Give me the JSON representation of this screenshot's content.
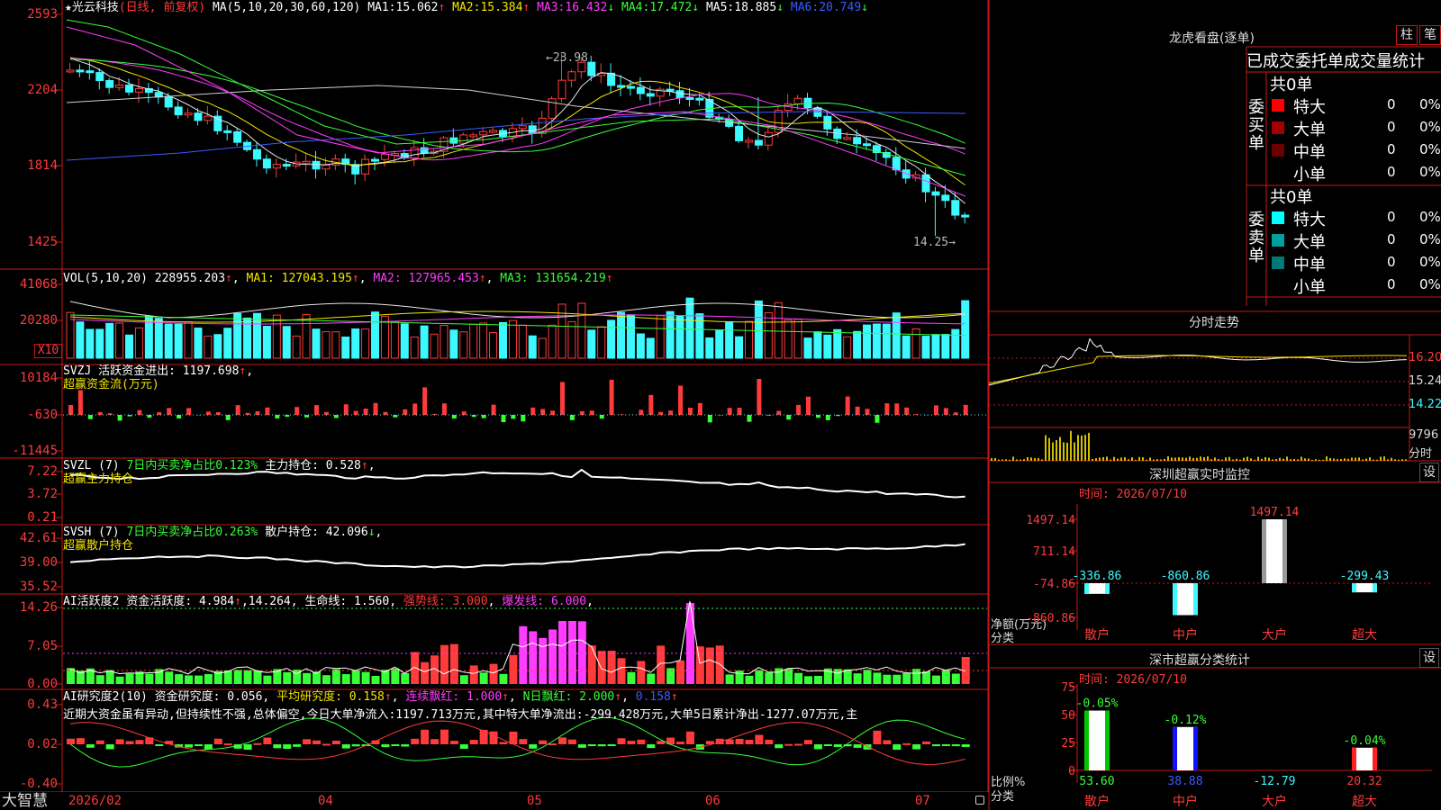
{
  "colors": {
    "up": "#ff3b3b",
    "down": "#3cf8ff",
    "border": "#c81818",
    "ma1": "#f2e600",
    "ma2": "#ff3cff",
    "ma3": "#38ff38",
    "ma4": "#3a5cff",
    "ma5": "#e6e6e6",
    "ma6": "#3a5cff"
  },
  "main": {
    "stock_name": "光云科技",
    "period": "(日线, 前复权)",
    "ma_label": "MA(5,10,20,30,60,120)",
    "ma": [
      {
        "label": "MA1:",
        "value": "15.062",
        "arrow": "↑"
      },
      {
        "label": "MA2:",
        "value": "15.384",
        "arrow": "↑"
      },
      {
        "label": "MA3:",
        "value": "16.432",
        "arrow": "↓"
      },
      {
        "label": "MA4:",
        "value": "17.472",
        "arrow": "↓"
      },
      {
        "label": "MA5:",
        "value": "18.885",
        "arrow": "↓"
      },
      {
        "label": "MA6:",
        "value": "20.749",
        "arrow": "↓"
      }
    ],
    "y_ticks": [
      "2593",
      "2204",
      "1814",
      "1425"
    ],
    "high_label": "23.98",
    "low_label": "14.25"
  },
  "vol": {
    "title": "VOL(5,10,20)",
    "value": "228955.203",
    "arrow": "↑",
    "ma1": "MA1: 127043.195",
    "ma1_arrow": "↑",
    "ma2": "MA2: 127965.453",
    "ma2_arrow": "↑",
    "ma3": "MA3: 131654.219",
    "ma3_arrow": "↑",
    "y_ticks": [
      "41068",
      "20280"
    ],
    "unit": "X10"
  },
  "svzj": {
    "title": "SVZJ",
    "desc": "活跃资金进出:",
    "value": "1197.698",
    "arrow": "↑",
    "sub": "超赢资金流(万元)",
    "y_ticks": [
      "10184",
      "-630",
      "-11445"
    ]
  },
  "svzl": {
    "title": "SVZL (7)",
    "desc": "7日内买卖净占比0.123%",
    "label2": "主力持仓:",
    "value": "0.528",
    "arrow": "↑",
    "sub": "超赢主力持仓",
    "y_ticks": [
      "7.22",
      "3.72",
      "0.21"
    ]
  },
  "svsh": {
    "title": "SVSH (7)",
    "desc": "7日内买卖净占比0.263%",
    "label2": "散户持仓:",
    "value": "42.096",
    "arrow": "↓",
    "sub": "超赢散户持仓",
    "y_ticks": [
      "42.61",
      "39.00",
      "35.52"
    ]
  },
  "ai1": {
    "title": "AI活跃度2",
    "desc": "资金活跃度:",
    "value": "4.984",
    "arrow": "↑",
    "v2": "14.264",
    "life": "生命线: 1.560",
    "strong": "强势线: 3.000",
    "burst": "爆发线: 6.000",
    "y_ticks": [
      "14.26",
      "7.05",
      "0.00"
    ]
  },
  "ai2": {
    "title": "AI研究度2(10)",
    "desc": "资金研究度: 0.056",
    "avg": "平均研究度: 0.158",
    "avg_arrow": "↑",
    "lianxu": "连续飘红: 1.000",
    "lianxu_arrow": "↑",
    "nday": "N日飘红: 2.000",
    "nday_arrow": "↑",
    "last": "0.158",
    "last_arrow": "↑",
    "comment": "近期大资金虽有异动,但持续性不强,总体偏空,今日大单净流入:1197.713万元,其中特大单净流出:-299.428万元,大单5日累计净出-1277.07万元,主",
    "y_ticks": [
      "0.43",
      "0.02",
      "-0.40"
    ]
  },
  "xaxis": {
    "brand": "大智慧",
    "labels": [
      "2026/02",
      "04",
      "05",
      "06",
      "07"
    ]
  },
  "lhb": {
    "title": "龙虎看盘(逐单)",
    "btn1": "柱",
    "btn2": "笔",
    "header": "已成交委托单成交量统计",
    "buy": {
      "side": "委买单",
      "total": "共0单",
      "rows": [
        {
          "name": "特大",
          "count": "0",
          "pct": "0%",
          "color": "#ff0000"
        },
        {
          "name": "大单",
          "count": "0",
          "pct": "0%",
          "color": "#a00000"
        },
        {
          "name": "中单",
          "count": "0",
          "pct": "0%",
          "color": "#6a0000"
        },
        {
          "name": "小单",
          "count": "0",
          "pct": "0%",
          "color": "#000"
        }
      ]
    },
    "sell": {
      "side": "委卖单",
      "total": "共0单",
      "rows": [
        {
          "name": "特大",
          "count": "0",
          "pct": "0%",
          "color": "#00ffff"
        },
        {
          "name": "大单",
          "count": "0",
          "pct": "0%",
          "color": "#00a0a0"
        },
        {
          "name": "中单",
          "count": "0",
          "pct": "0%",
          "color": "#007878"
        },
        {
          "name": "小单",
          "count": "0",
          "pct": "0%",
          "color": "#000"
        }
      ]
    }
  },
  "intraday": {
    "title": "分时走势",
    "prices": [
      "16.20",
      "15.24",
      "14.22"
    ],
    "vol": "9796",
    "unit": "分时"
  },
  "sz_monitor": {
    "title": "深圳超赢实时监控",
    "btn": "设",
    "time": "时间: 2026/07/10",
    "y_ticks": [
      "1497.14",
      "711.14",
      "-74.86",
      "-860.86"
    ],
    "ylabel": "净额(万元)",
    "xlabel": "分类",
    "chart_data": {
      "type": "bar",
      "categories": [
        "散户",
        "中户",
        "大户",
        "超大"
      ],
      "values": [
        -336.86,
        -860.86,
        1497.14,
        -299.43
      ],
      "value_labels": [
        "-336.86",
        "-860.86",
        "1497.14",
        "-299.43"
      ],
      "ylim": [
        -860.86,
        1497.14
      ]
    }
  },
  "sz_class": {
    "title": "深市超赢分类统计",
    "btn": "设",
    "time": "时间: 2026/07/10",
    "y_ticks": [
      "75",
      "50",
      "25",
      "0"
    ],
    "ylabel": "比例%",
    "xlabel": "分类",
    "chart_data": {
      "type": "bar",
      "categories": [
        "散户",
        "中户",
        "大户",
        "超大"
      ],
      "values": [
        53.6,
        38.88,
        -12.79,
        20.32
      ],
      "value_labels": [
        "53.60",
        "38.88",
        "-12.79",
        "20.32"
      ],
      "top_labels": [
        "-0.05%",
        "-0.12%",
        "",
        "-0.04%"
      ],
      "ylim": [
        0,
        75
      ]
    }
  }
}
